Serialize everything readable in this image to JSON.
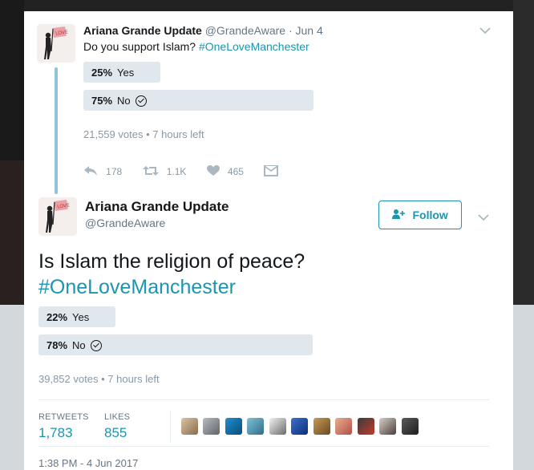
{
  "tweet1": {
    "name": "Ariana Grande Update",
    "handle": "@GrandeAware",
    "separator": "·",
    "date": "Jun 4",
    "text": "Do you support Islam?",
    "hashtag": "#OneLoveManchester",
    "poll": [
      {
        "pct": "25%",
        "label": "Yes",
        "fraction": 0.25,
        "selected": false
      },
      {
        "pct": "75%",
        "label": "No",
        "fraction": 0.75,
        "selected": true
      }
    ],
    "votes": "21,559 votes",
    "time_left": "7 hours left",
    "actions": {
      "reply": "178",
      "retweet": "1.1K",
      "like": "465"
    }
  },
  "tweet2": {
    "name": "Ariana Grande Update",
    "handle": "@GrandeAware",
    "follow_label": "Follow",
    "text": "Is Islam the religion of peace?",
    "hashtag": "#OneLoveManchester",
    "poll": [
      {
        "pct": "22%",
        "label": "Yes",
        "fraction": 0.22,
        "selected": false
      },
      {
        "pct": "78%",
        "label": "No",
        "fraction": 0.78,
        "selected": true
      }
    ],
    "votes": "39,852 votes",
    "time_left": "7 hours left",
    "stats": {
      "retweets_label": "RETWEETS",
      "retweets": "1,783",
      "likes_label": "LIKES",
      "likes": "855"
    },
    "timestamp": "1:38 PM - 4 Jun 2017"
  },
  "meta_separator": "•",
  "colors": {
    "accent": "#1b95b0",
    "poll_bar": "#e1e8ed",
    "muted": "#8899a6",
    "thread_line": "#8fc5d8"
  },
  "icons": {
    "reply": "reply-icon",
    "retweet": "retweet-icon",
    "like": "heart-icon",
    "dm": "direct-message-icon",
    "caret": "chevron-down-icon",
    "follow": "add-user-icon"
  }
}
